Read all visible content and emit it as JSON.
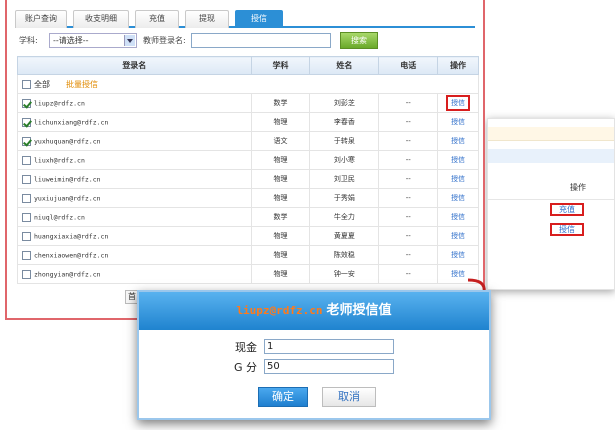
{
  "tabs": [
    {
      "label": "账户查询"
    },
    {
      "label": "收支明细"
    },
    {
      "label": "充值"
    },
    {
      "label": "提现"
    },
    {
      "label": "授信"
    }
  ],
  "search": {
    "subject_label": "学科:",
    "subject_value": "--请选择--",
    "teacher_label": "教师登录名:",
    "teacher_value": "",
    "button": "搜索"
  },
  "table": {
    "headers": [
      "登录名",
      "学科",
      "姓名",
      "电话",
      "操作"
    ],
    "select_all": "全部",
    "batch_grant": "批量授信",
    "rows": [
      {
        "login": "liupz@rdfz.cn",
        "subject": "数学",
        "name": "刘彭芝",
        "phone": "--",
        "action": "授信",
        "checked": true
      },
      {
        "login": "lichunxiang@rdfz.cn",
        "subject": "物理",
        "name": "李春香",
        "phone": "--",
        "action": "授信",
        "checked": true
      },
      {
        "login": "yuxhuquan@rdfz.cn",
        "subject": "语文",
        "name": "于转泉",
        "phone": "--",
        "action": "授信",
        "checked": true
      },
      {
        "login": "liuxh@rdfz.cn",
        "subject": "物理",
        "name": "刘小寒",
        "phone": "--",
        "action": "授信",
        "checked": false
      },
      {
        "login": "liuweimin@rdfz.cn",
        "subject": "物理",
        "name": "刘卫民",
        "phone": "--",
        "action": "授信",
        "checked": false
      },
      {
        "login": "yuxiujuan@rdfz.cn",
        "subject": "物理",
        "name": "于秀娟",
        "phone": "--",
        "action": "授信",
        "checked": false
      },
      {
        "login": "niuql@rdfz.cn",
        "subject": "数学",
        "name": "牛全力",
        "phone": "--",
        "action": "授信",
        "checked": false
      },
      {
        "login": "huangxiaxia@rdfz.cn",
        "subject": "物理",
        "name": "黄夏夏",
        "phone": "--",
        "action": "授信",
        "checked": false
      },
      {
        "login": "chenxiaowen@rdfz.cn",
        "subject": "物理",
        "name": "陈效稳",
        "phone": "--",
        "action": "授信",
        "checked": false
      },
      {
        "login": "zhongyian@rdfz.cn",
        "subject": "物理",
        "name": "钟一安",
        "phone": "--",
        "action": "授信",
        "checked": false
      }
    ]
  },
  "pager": {
    "first": "首"
  },
  "back_panel": {
    "column": "操作",
    "links": [
      "充值",
      "授信"
    ]
  },
  "dialog": {
    "email": "liupz@rdfz.cn",
    "title": "老师授信值",
    "cash_label": "现金",
    "cash_value": "1",
    "gpoints_label": "G 分",
    "gpoints_value": "50",
    "confirm": "确定",
    "cancel": "取消"
  },
  "colors": {
    "accent": "#2c8fd6",
    "highlight": "#d81e1e",
    "link": "#2b6cc9",
    "batch": "#e08a00",
    "email": "#ff7a1a"
  }
}
